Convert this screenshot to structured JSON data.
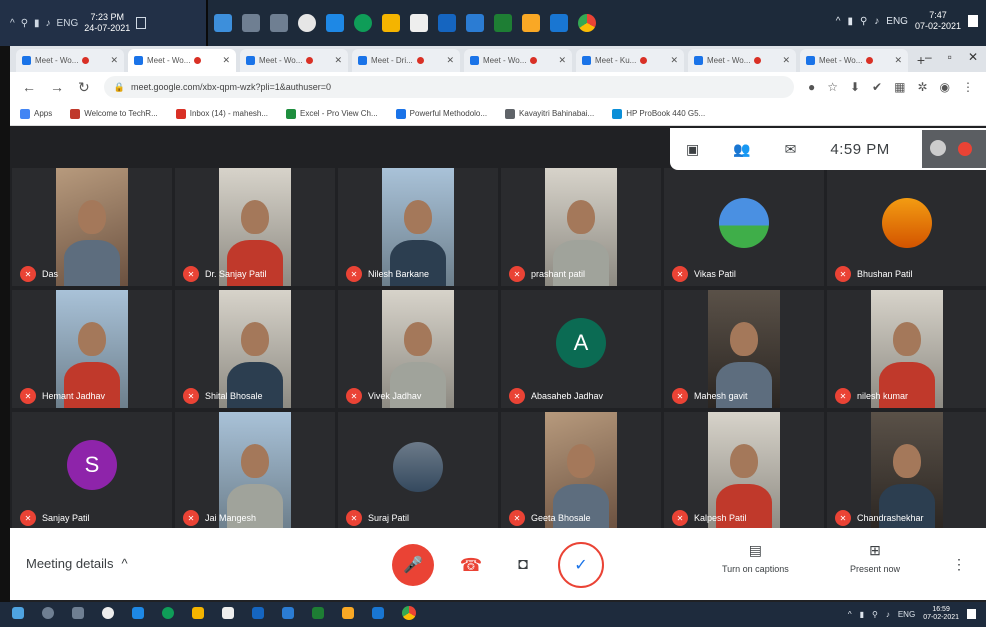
{
  "top_taskbar": {
    "left_tray_lang": "ENG",
    "left_clock_time": "7:23 PM",
    "left_clock_date": "24-07-2021",
    "right_tray_lang": "ENG",
    "right_clock_time": "7:47",
    "right_clock_date": "07-02-2021"
  },
  "browser": {
    "tabs": [
      {
        "label": "Meet - Wo...",
        "active": false
      },
      {
        "label": "Meet - Wo...",
        "active": true
      },
      {
        "label": "Meet - Wo...",
        "active": false
      },
      {
        "label": "Meet - Dri...",
        "active": false
      },
      {
        "label": "Meet - Wo...",
        "active": false
      },
      {
        "label": "Meet - Ku...",
        "active": false
      },
      {
        "label": "Meet - Wo...",
        "active": false
      },
      {
        "label": "Meet - Wo...",
        "active": false
      }
    ],
    "url": "meet.google.com/xbx-qpm-wzk?pli=1&authuser=0",
    "bookmarks": [
      {
        "label": "Apps",
        "color": "#4285f4"
      },
      {
        "label": "Welcome to TechR...",
        "color": "#c0392b"
      },
      {
        "label": "Inbox (14) - mahesh...",
        "color": "#d93025"
      },
      {
        "label": "Excel - Pro View Ch...",
        "color": "#1e8e3e"
      },
      {
        "label": "Powerful Methodolo...",
        "color": "#1a73e8"
      },
      {
        "label": "Kavayitri Bahinabai...",
        "color": "#5f6368"
      },
      {
        "label": "HP ProBook 440 G5...",
        "color": "#0b8fd8"
      }
    ]
  },
  "meet": {
    "time": "4:59 PM",
    "participants": [
      {
        "name": "Das",
        "photo": "p-warm"
      },
      {
        "name": "Dr. Sanjay Patil",
        "photo": "p-room"
      },
      {
        "name": "Nilesh Barkane",
        "photo": "p-sky"
      },
      {
        "name": "prashant patil",
        "photo": "p-room"
      },
      {
        "name": "Vikas Patil",
        "avatar": "landscape"
      },
      {
        "name": "Bhushan Patil",
        "avatar": "sunset"
      },
      {
        "name": "Hemant Jadhav",
        "photo": "p-sky"
      },
      {
        "name": "Shital Bhosale",
        "photo": "p-room"
      },
      {
        "name": "Vivek Jadhav",
        "photo": "p-room"
      },
      {
        "name": "Abasaheb Jadhav",
        "letter": "A",
        "color": "#0b6b53"
      },
      {
        "name": "Mahesh gavit",
        "photo": "p-dark"
      },
      {
        "name": "nilesh kumar",
        "photo": "p-room"
      },
      {
        "name": "Sanjay Patil",
        "letter": "S",
        "color": "#8e24aa"
      },
      {
        "name": "Jai Mangesh",
        "photo": "p-sky"
      },
      {
        "name": "Suraj Patil",
        "avatar": "photo"
      },
      {
        "name": "Geeta Bhosale",
        "photo": "p-warm"
      },
      {
        "name": "Kalpesh Patil",
        "photo": "p-room"
      },
      {
        "name": "Chandrashekhar",
        "photo": "p-dark"
      }
    ],
    "controls": {
      "meeting_details": "Meeting details",
      "captions_label": "Turn on captions",
      "present_label": "Present now"
    }
  },
  "bottom_taskbar": {
    "lang": "ENG",
    "clock_time": "16:59",
    "clock_date": "07-02-2021"
  }
}
